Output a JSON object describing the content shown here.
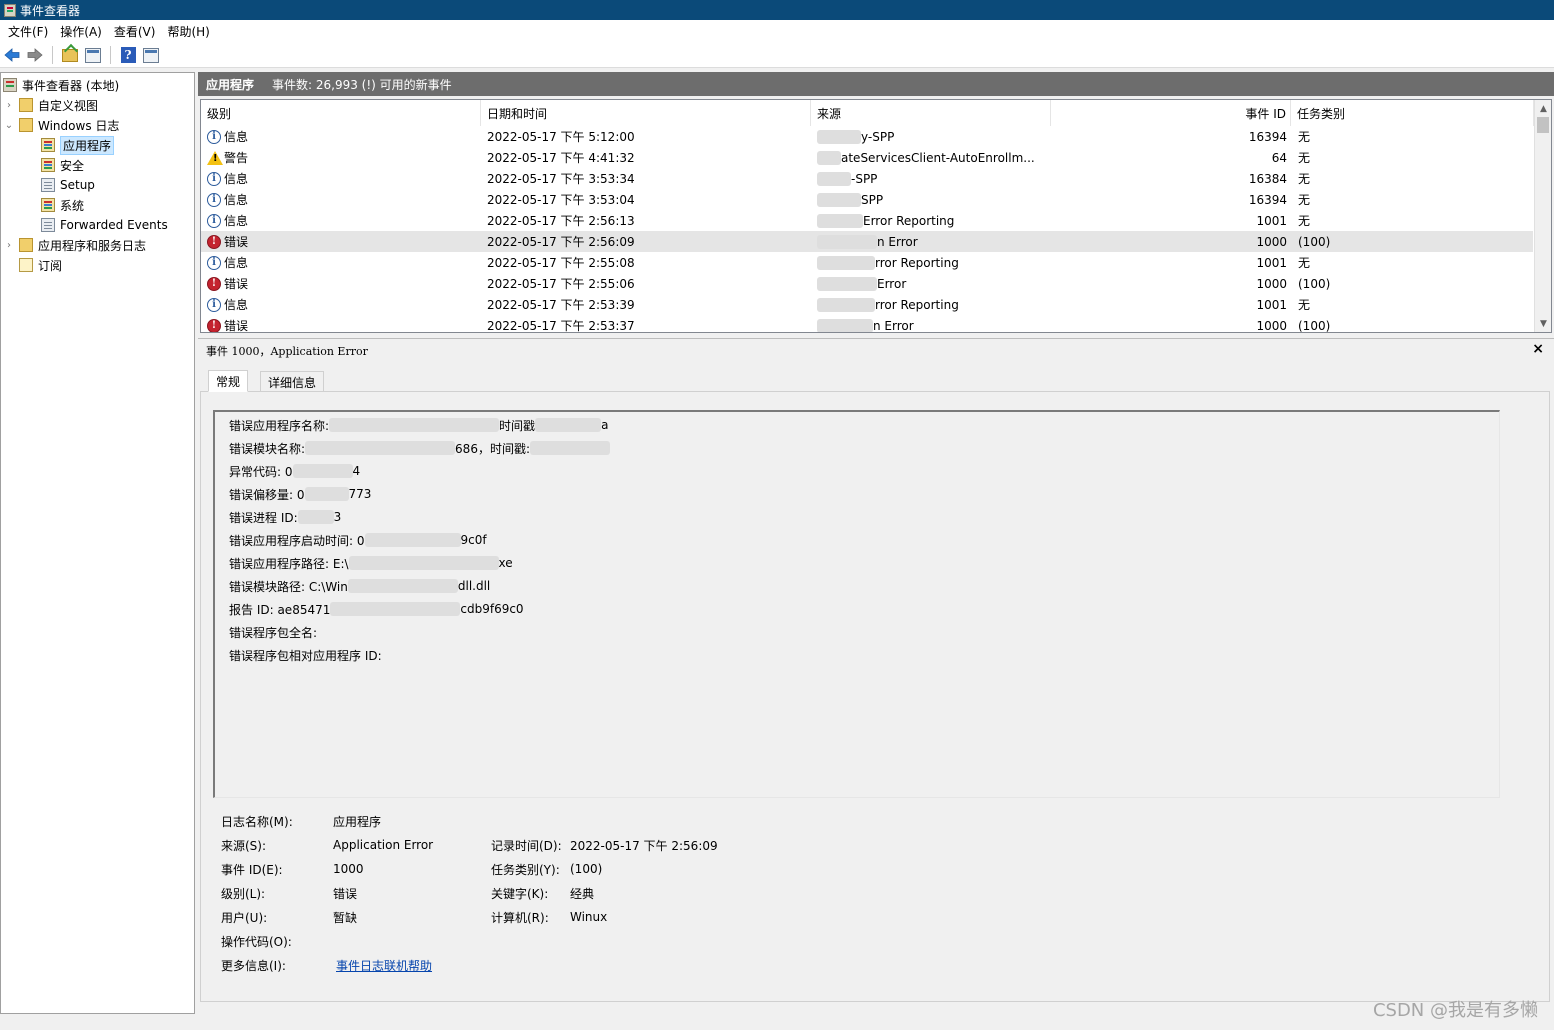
{
  "window": {
    "title": "事件查看器"
  },
  "menu": [
    "文件(F)",
    "操作(A)",
    "查看(V)",
    "帮助(H)"
  ],
  "toolbar": {
    "icons": [
      "back-arrow-icon",
      "forward-arrow-icon",
      "up-folder-icon",
      "show-hide-tree-icon",
      "help-icon",
      "show-action-pane-icon"
    ]
  },
  "tree": {
    "root": "事件查看器 (本地)",
    "custom_views": "自定义视图",
    "windows_logs": "Windows 日志",
    "logs": [
      "应用程序",
      "安全",
      "Setup",
      "系统",
      "Forwarded Events"
    ],
    "app_service_logs": "应用程序和服务日志",
    "subscriptions": "订阅"
  },
  "list_header": {
    "name": "应用程序",
    "summary": "事件数: 26,993 (!) 可用的新事件"
  },
  "columns": {
    "level": "级别",
    "datetime": "日期和时间",
    "source": "来源",
    "event_id": "事件 ID",
    "task": "任务类别"
  },
  "events": [
    {
      "level": "信息",
      "type": "info",
      "datetime": "2022-05-17 下午 5:12:00",
      "source": "y-SPP",
      "event_id": "16394",
      "task": "无"
    },
    {
      "level": "警告",
      "type": "warn",
      "datetime": "2022-05-17 下午 4:41:32",
      "source": "ateServicesClient-AutoEnrollm...",
      "event_id": "64",
      "task": "无"
    },
    {
      "level": "信息",
      "type": "info",
      "datetime": "2022-05-17 下午 3:53:34",
      "source": "-SPP",
      "event_id": "16384",
      "task": "无"
    },
    {
      "level": "信息",
      "type": "info",
      "datetime": "2022-05-17 下午 3:53:04",
      "source": "SPP",
      "event_id": "16394",
      "task": "无"
    },
    {
      "level": "信息",
      "type": "info",
      "datetime": "2022-05-17 下午 2:56:13",
      "source": "Error Reporting",
      "event_id": "1001",
      "task": "无"
    },
    {
      "level": "错误",
      "type": "err",
      "datetime": "2022-05-17 下午 2:56:09",
      "source": "n Error",
      "event_id": "1000",
      "task": "(100)"
    },
    {
      "level": "信息",
      "type": "info",
      "datetime": "2022-05-17 下午 2:55:08",
      "source": "rror Reporting",
      "event_id": "1001",
      "task": "无"
    },
    {
      "level": "错误",
      "type": "err",
      "datetime": "2022-05-17 下午 2:55:06",
      "source": "Error",
      "event_id": "1000",
      "task": "(100)"
    },
    {
      "level": "信息",
      "type": "info",
      "datetime": "2022-05-17 下午 2:53:39",
      "source": "rror Reporting",
      "event_id": "1001",
      "task": "无"
    },
    {
      "level": "错误",
      "type": "err",
      "datetime": "2022-05-17 下午 2:53:37",
      "source": "n Error",
      "event_id": "1000",
      "task": "(100)"
    }
  ],
  "detail": {
    "title": "事件 1000，Application Error",
    "close": "×",
    "tabs": [
      "常规",
      "详细信息"
    ],
    "message_lines": [
      {
        "label": "错误应用程序名称:",
        "tail": "时间戳",
        "end": "a"
      },
      {
        "label": "错误模块名称:",
        "tail": "686，时间戳:",
        "end": ""
      },
      {
        "label": "异常代码: 0",
        "tail": "4",
        "end": ""
      },
      {
        "label": "错误偏移量: 0",
        "tail": "773",
        "end": ""
      },
      {
        "label": "错误进程 ID: ",
        "tail": "3",
        "end": ""
      },
      {
        "label": "错误应用程序启动时间: 0",
        "tail": "9c0f",
        "end": ""
      },
      {
        "label": "错误应用程序路径: E:\\",
        "tail": "xe",
        "end": ""
      },
      {
        "label": "错误模块路径: C:\\Win",
        "tail": "dll.dll",
        "end": ""
      },
      {
        "label": "报告 ID: ae85471",
        "tail": "cdb9f69c0",
        "end": ""
      },
      {
        "label": "错误程序包全名:",
        "tail": "",
        "end": ""
      },
      {
        "label": "错误程序包相对应用程序 ID:",
        "tail": "",
        "end": ""
      }
    ],
    "props": {
      "log_name_label": "日志名称(M):",
      "log_name": "应用程序",
      "source_label": "来源(S):",
      "source": "Application Error",
      "logged_label": "记录时间(D):",
      "logged": "2022-05-17 下午 2:56:09",
      "event_id_label": "事件 ID(E):",
      "event_id": "1000",
      "task_label": "任务类别(Y):",
      "task": "(100)",
      "level_label": "级别(L):",
      "level": "错误",
      "keywords_label": "关键字(K):",
      "keywords": "经典",
      "user_label": "用户(U):",
      "user": "暂缺",
      "computer_label": "计算机(R):",
      "computer": "Winux",
      "opcode_label": "操作代码(O):",
      "more_info_label": "更多信息(I):",
      "more_info_link": "事件日志联机帮助"
    }
  },
  "watermark": "CSDN @我是有多懒"
}
